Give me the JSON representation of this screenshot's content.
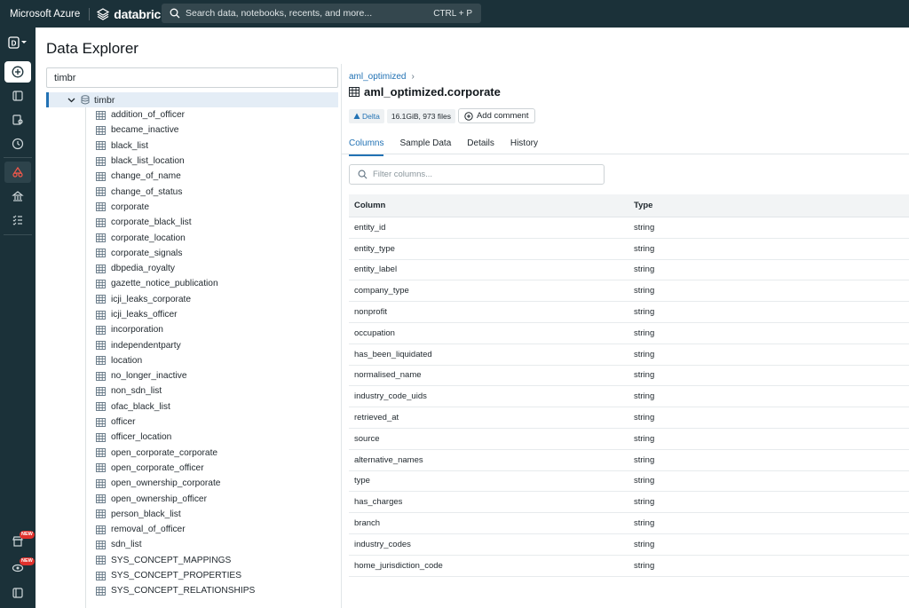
{
  "topbar": {
    "cloud": "Microsoft Azure",
    "brand": "databricks",
    "search_placeholder": "Search data, notebooks, recents, and more...",
    "search_shortcut": "CTRL + P"
  },
  "leftnav": {
    "workspace_badge": "D",
    "new_badge_1": "NEW",
    "new_badge_2": "NEW"
  },
  "page": {
    "title": "Data Explorer",
    "filter_value": "timbr"
  },
  "tree": {
    "root": "timbr",
    "items": [
      "addition_of_officer",
      "became_inactive",
      "black_list",
      "black_list_location",
      "change_of_name",
      "change_of_status",
      "corporate",
      "corporate_black_list",
      "corporate_location",
      "corporate_signals",
      "dbpedia_royalty",
      "gazette_notice_publication",
      "icji_leaks_corporate",
      "icji_leaks_officer",
      "incorporation",
      "independentparty",
      "location",
      "no_longer_inactive",
      "non_sdn_list",
      "ofac_black_list",
      "officer",
      "officer_location",
      "open_corporate_corporate",
      "open_corporate_officer",
      "open_ownership_corporate",
      "open_ownership_officer",
      "person_black_list",
      "removal_of_officer",
      "sdn_list",
      "SYS_CONCEPT_MAPPINGS",
      "SYS_CONCEPT_PROPERTIES",
      "SYS_CONCEPT_RELATIONSHIPS"
    ]
  },
  "detail": {
    "breadcrumb": "aml_optimized",
    "title": "aml_optimized.corporate",
    "tag_format": "Delta",
    "tag_size": "16.1GiB, 973 files",
    "add_comment": "Add comment",
    "tabs": [
      "Columns",
      "Sample Data",
      "Details",
      "History"
    ],
    "active_tab": "Columns",
    "filter_placeholder": "Filter columns...",
    "table": {
      "headers": [
        "Column",
        "Type"
      ],
      "rows": [
        [
          "entity_id",
          "string"
        ],
        [
          "entity_type",
          "string"
        ],
        [
          "entity_label",
          "string"
        ],
        [
          "company_type",
          "string"
        ],
        [
          "nonprofit",
          "string"
        ],
        [
          "occupation",
          "string"
        ],
        [
          "has_been_liquidated",
          "string"
        ],
        [
          "normalised_name",
          "string"
        ],
        [
          "industry_code_uids",
          "string"
        ],
        [
          "retrieved_at",
          "string"
        ],
        [
          "source",
          "string"
        ],
        [
          "alternative_names",
          "string"
        ],
        [
          "type",
          "string"
        ],
        [
          "has_charges",
          "string"
        ],
        [
          "branch",
          "string"
        ],
        [
          "industry_codes",
          "string"
        ],
        [
          "home_jurisdiction_code",
          "string"
        ]
      ]
    }
  },
  "colors": {
    "nav_bg": "#1b3139",
    "accent": "#2272b4",
    "badge": "#e0312c"
  }
}
